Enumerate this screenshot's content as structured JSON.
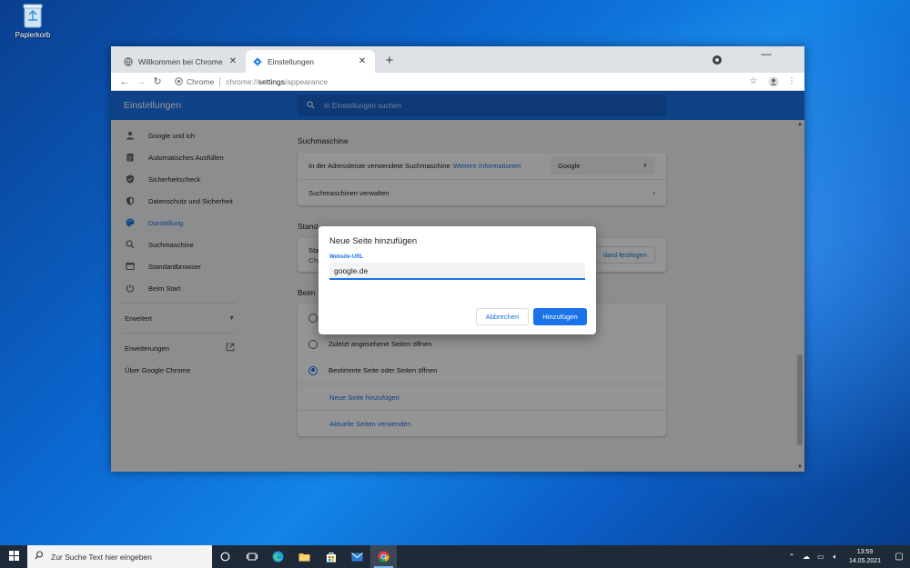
{
  "desktop": {
    "recycle_bin_label": "Papierkorb"
  },
  "browser": {
    "tabs": [
      {
        "label": "Willkommen bei Chrome",
        "active": false
      },
      {
        "label": "Einstellungen",
        "active": true
      }
    ],
    "new_tab": "+",
    "window_controls": {
      "minimize": "—",
      "maximize": "☐",
      "close": "✕"
    },
    "omnibox": {
      "chip": "Chrome",
      "scheme": "chrome://",
      "host": "settings",
      "path": "/appearance"
    }
  },
  "settings": {
    "title": "Einstellungen",
    "search_placeholder": "In Einstellungen suchen",
    "sidebar": {
      "items": [
        {
          "label": "Google und ich",
          "icon": "person-icon"
        },
        {
          "label": "Automatisches Ausfüllen",
          "icon": "clipboard-icon"
        },
        {
          "label": "Sicherheitscheck",
          "icon": "shield-check-icon"
        },
        {
          "label": "Datenschutz und Sicherheit",
          "icon": "shield-icon"
        },
        {
          "label": "Darstellung",
          "icon": "palette-icon",
          "active": true
        },
        {
          "label": "Suchmaschine",
          "icon": "search-icon"
        },
        {
          "label": "Standardbrowser",
          "icon": "browser-icon"
        },
        {
          "label": "Beim Start",
          "icon": "power-icon"
        }
      ],
      "advanced": "Erweitert",
      "extensions": "Erweiterungen",
      "about": "Über Google Chrome"
    },
    "search_engine": {
      "section_title": "Suchmaschine",
      "row1_label": "In der Adressleiste verwendete Suchmaschine",
      "row1_link": "Weitere Informationen",
      "row1_value": "Google",
      "row2_label": "Suchmaschinen verwalten"
    },
    "default_browser": {
      "section_title": "Stand",
      "row_text_1": "Sta",
      "row_text_2": "Chr",
      "button": "dard festlegen"
    },
    "on_startup": {
      "section_title": "Beim",
      "options": [
        {
          "label": "Zuletzt angesehene Seiten öffnen",
          "selected": false
        },
        {
          "label": "Bestimmte Seite oder Seiten öffnen",
          "selected": true
        }
      ],
      "link_add": "Neue Seite hinzufügen",
      "link_use_current": "Aktuelle Seiten verwenden"
    }
  },
  "dialog": {
    "title": "Neue Seite hinzufügen",
    "field_label": "Website-URL",
    "field_value": "google.de",
    "cancel": "Abbrechen",
    "add": "Hinzufügen"
  },
  "taskbar": {
    "search_placeholder": "Zur Suche Text hier eingeben",
    "time": "13:59",
    "date": "14.05.2021"
  },
  "colors": {
    "accent": "#1a73e8",
    "taskbar": "#1f2a38"
  }
}
